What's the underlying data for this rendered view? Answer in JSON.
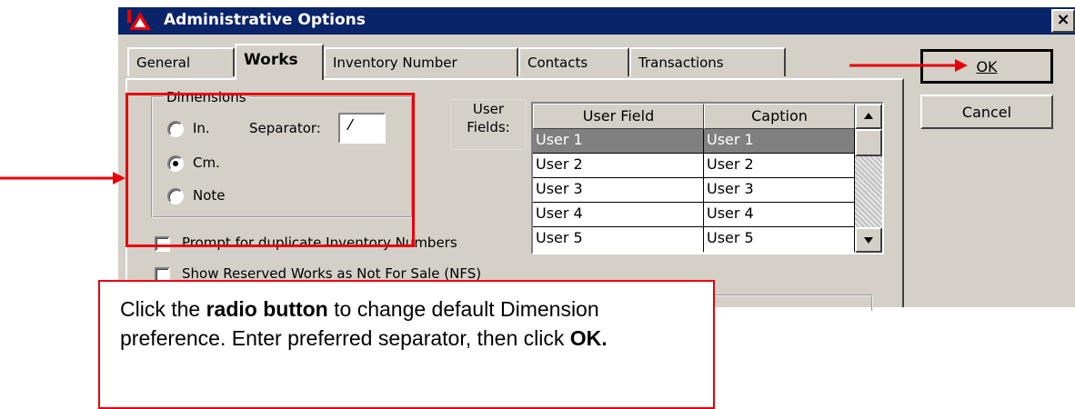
{
  "window": {
    "title": "Administrative Options",
    "close_glyph": "×",
    "app_icon": "museum-app-icon"
  },
  "tabs": [
    {
      "label": "General"
    },
    {
      "label": "Works",
      "active": true
    },
    {
      "label": "Inventory Number"
    },
    {
      "label": "Contacts"
    },
    {
      "label": "Transactions"
    }
  ],
  "dimensions": {
    "legend": "Dimensions",
    "options": [
      {
        "label": "In.",
        "selected": false
      },
      {
        "label": "Cm.",
        "selected": true
      },
      {
        "label": "Note",
        "selected": false
      }
    ],
    "separator_label": "Separator:",
    "separator_value": "/"
  },
  "user_fields": {
    "label_line1": "User",
    "label_line2": "Fields:",
    "columns": [
      "User Field",
      "Caption"
    ],
    "rows": [
      {
        "field": "User 1",
        "caption": "User 1",
        "selected": true
      },
      {
        "field": "User 2",
        "caption": "User 2"
      },
      {
        "field": "User 3",
        "caption": "User 3"
      },
      {
        "field": "User 4",
        "caption": "User 4"
      },
      {
        "field": "User 5",
        "caption": "User 5"
      }
    ]
  },
  "checkboxes": [
    {
      "label": "Prompt for duplicate Inventory Numbers",
      "checked": false
    },
    {
      "label": "Show Reserved Works as Not For Sale (NFS)",
      "checked": false
    }
  ],
  "buttons": {
    "ok_label": "OK",
    "cancel_label": "Cancel"
  },
  "callout": {
    "part1": "Click the ",
    "bold1": "radio button",
    "part2": " to change default Dimension preference. Enter preferred separator, then click ",
    "bold2": "OK."
  },
  "colors": {
    "titlebar": "#0a246a",
    "annotation_red": "#e8000a",
    "dialog_face": "#d4d0c8",
    "selection": "#808080"
  }
}
